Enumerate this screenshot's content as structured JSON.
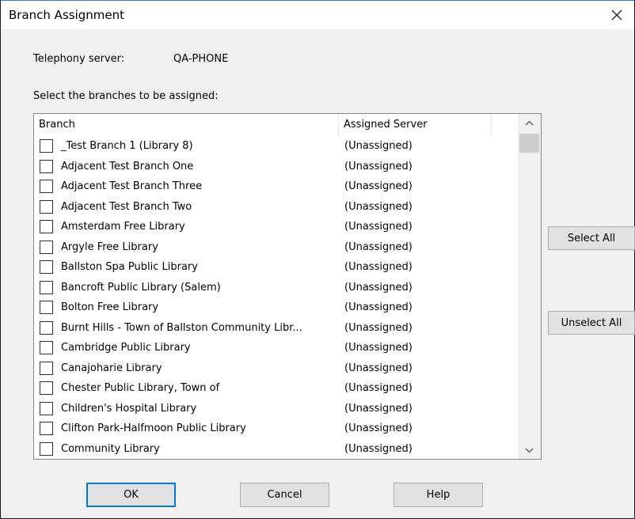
{
  "window": {
    "title": "Branch Assignment"
  },
  "server": {
    "label": "Telephony server:",
    "value": "QA-PHONE"
  },
  "instructions": "Select the branches to be assigned:",
  "table": {
    "columns": [
      "Branch",
      "Assigned Server"
    ],
    "rows": [
      {
        "branch": "_Test Branch 1 (Library 8)",
        "server": "(Unassigned)",
        "checked": false
      },
      {
        "branch": "Adjacent Test Branch One",
        "server": "(Unassigned)",
        "checked": false
      },
      {
        "branch": "Adjacent Test Branch Three",
        "server": "(Unassigned)",
        "checked": false
      },
      {
        "branch": "Adjacent Test Branch Two",
        "server": "(Unassigned)",
        "checked": false
      },
      {
        "branch": "Amsterdam Free Library",
        "server": "(Unassigned)",
        "checked": false
      },
      {
        "branch": "Argyle Free Library",
        "server": "(Unassigned)",
        "checked": false
      },
      {
        "branch": "Ballston Spa Public Library",
        "server": "(Unassigned)",
        "checked": false
      },
      {
        "branch": "Bancroft Public Library (Salem)",
        "server": "(Unassigned)",
        "checked": false
      },
      {
        "branch": "Bolton Free Library",
        "server": "(Unassigned)",
        "checked": false
      },
      {
        "branch": "Burnt Hills - Town of Ballston Community Libr...",
        "server": "(Unassigned)",
        "checked": false
      },
      {
        "branch": "Cambridge Public Library",
        "server": "(Unassigned)",
        "checked": false
      },
      {
        "branch": "Canajoharie Library",
        "server": "(Unassigned)",
        "checked": false
      },
      {
        "branch": "Chester Public Library, Town of",
        "server": "(Unassigned)",
        "checked": false
      },
      {
        "branch": "Children's Hospital Library",
        "server": "(Unassigned)",
        "checked": false
      },
      {
        "branch": "Clifton Park-Halfmoon Public Library",
        "server": "(Unassigned)",
        "checked": false
      },
      {
        "branch": "Community Library",
        "server": "(Unassigned)",
        "checked": false
      }
    ]
  },
  "side_buttons": {
    "select_all": "Select All",
    "unselect_all": "Unselect All"
  },
  "footer_buttons": {
    "ok": "OK",
    "cancel": "Cancel",
    "help": "Help"
  },
  "icons": {
    "close": "close-icon",
    "scroll_up": "chevron-up-icon",
    "scroll_down": "chevron-down-icon"
  },
  "colors": {
    "accent": "#0078d7",
    "dialog_bg": "#f0f0f0"
  }
}
